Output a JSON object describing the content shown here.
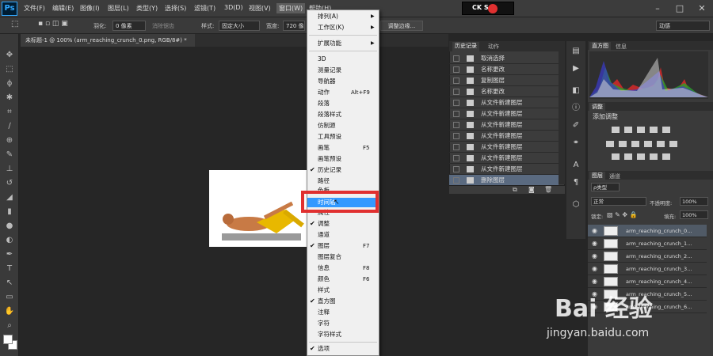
{
  "app": {
    "logo": "Ps"
  },
  "menubar": {
    "items": [
      "文件(F)",
      "编辑(E)",
      "图像(I)",
      "图层(L)",
      "类型(Y)",
      "选择(S)",
      "滤镜(T)",
      "3D(D)",
      "视图(V)",
      "窗口(W)",
      "帮助(H)"
    ]
  },
  "tray": {
    "text": "CK S"
  },
  "optbar": {
    "feather_label": "羽化:",
    "feather_value": "0 像素",
    "antialias_label": "消除锯齿",
    "style_label": "样式:",
    "style_value": "固定大小",
    "width_label": "宽度:",
    "width_value": "720 像",
    "refine_button": "调整边缘...",
    "workspace": "动感"
  },
  "doc": {
    "tab_title": "未标题-1 @ 100% (arm_reaching_crunch_0.png, RGB/8#) *"
  },
  "window_menu": {
    "items": [
      {
        "label": "排列(A)",
        "submenu": true
      },
      {
        "label": "工作区(K)",
        "submenu": true
      },
      {
        "label": "扩展功能",
        "submenu": true
      },
      {
        "label": "3D"
      },
      {
        "label": "测量记录"
      },
      {
        "label": "导航器"
      },
      {
        "label": "动作",
        "shortcut": "Alt+F9"
      },
      {
        "label": "段落"
      },
      {
        "label": "段落样式"
      },
      {
        "label": "仿制源"
      },
      {
        "label": "工具预设"
      },
      {
        "label": "画笔",
        "shortcut": "F5"
      },
      {
        "label": "画笔预设"
      },
      {
        "label": "历史记录",
        "checked": true
      },
      {
        "label": "路径"
      },
      {
        "label": "色板"
      },
      {
        "label": "时间轴",
        "highlighted": true
      },
      {
        "label": "属性"
      },
      {
        "label": "调整",
        "checked": true
      },
      {
        "label": "通道"
      },
      {
        "label": "图层",
        "shortcut": "F7",
        "checked": true
      },
      {
        "label": "图层复合"
      },
      {
        "label": "信息",
        "shortcut": "F8"
      },
      {
        "label": "颜色",
        "shortcut": "F6"
      },
      {
        "label": "样式"
      },
      {
        "label": "直方图",
        "checked": true
      },
      {
        "label": "注释"
      },
      {
        "label": "字符"
      },
      {
        "label": "字符样式"
      },
      {
        "label": "选项",
        "checked": true
      }
    ]
  },
  "history_panel": {
    "tab_history": "历史记录",
    "tab_actions": "动作",
    "rows": [
      "取消选择",
      "名称更改",
      "复制图层",
      "名称更改",
      "从文件新建图层",
      "从文件新建图层",
      "从文件新建图层",
      "从文件新建图层",
      "从文件新建图层",
      "从文件新建图层",
      "从文件新建图层",
      "删除图层"
    ]
  },
  "histogram_panel": {
    "tab_histogram": "直方图",
    "tab_info": "信息"
  },
  "adjust_panel": {
    "tab": "调整",
    "title": "添加调整"
  },
  "layers_panel": {
    "tab_layers": "图层",
    "tab_channels": "通道",
    "kind_label": "ρ类型",
    "blend_mode": "正常",
    "opacity_label": "不透明度:",
    "opacity_value": "100%",
    "lock_label": "锁定:",
    "fill_label": "填充:",
    "fill_value": "100%",
    "layers": [
      "arm_reaching_crunch_0...",
      "arm_reaching_crunch_1...",
      "arm_reaching_crunch_2...",
      "arm_reaching_crunch_3...",
      "arm_reaching_crunch_4...",
      "arm_reaching_crunch_5...",
      "arm_reaching_crunch_6..."
    ]
  },
  "watermark": {
    "logo": "Bai 经验",
    "url": "jingyan.baidu.com"
  }
}
